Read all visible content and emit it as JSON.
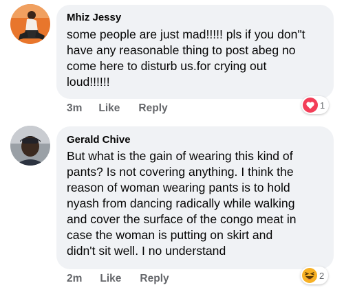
{
  "comments": [
    {
      "author": "Mhiz Jessy",
      "text": "some people are just mad!!!!! pls if you don\"t\nhave any reasonable thing to post abeg no\ncome here to disturb us.for crying out\nloud!!!!!!",
      "time": "3m",
      "like_label": "Like",
      "reply_label": "Reply",
      "reaction_icon": "love-icon",
      "reaction_count": "1"
    },
    {
      "author": "Gerald Chive",
      "text": "But what is the gain of wearing this kind of\npants? Is not covering anything. I think the\nreason of woman wearing pants is to hold\nnyash from dancing radically while walking\nand cover the surface of the congo meat in\ncase the woman is putting on skirt and\ndidn't sit well. I no understand",
      "time": "2m",
      "like_label": "Like",
      "reply_label": "Reply",
      "reaction_icon": "haha-icon",
      "reaction_count": "2"
    }
  ],
  "colors": {
    "bubble": "#f0f2f5",
    "meta_text": "#65676b",
    "love_red": "#f33e58",
    "haha_yellow": "#f7b125",
    "avatar1_bg": "#e8762c"
  }
}
